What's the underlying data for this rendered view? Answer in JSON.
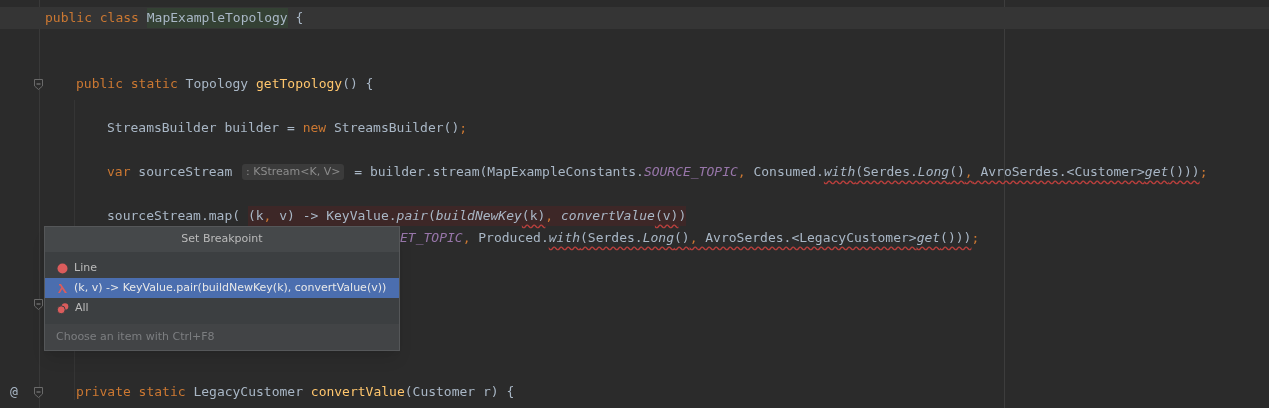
{
  "lines": [
    {
      "current": true,
      "fold": false,
      "covered_left": false,
      "tokens": [
        {
          "text": "public class ",
          "kind": "keyword",
          "squiggly": false
        },
        {
          "text": "MapExampleTopology",
          "kind": "declared",
          "squiggly": false
        },
        {
          "text": " {",
          "kind": "plain",
          "squiggly": false
        }
      ],
      "children": [
        {
          "fold": false
        },
        {
          "fold": false
        },
        {
          "fold": true,
          "covered_left": false,
          "tokens": [
            {
              "text": "public static",
              "kind": "keyword",
              "squiggly": false
            },
            {
              "text": " Topology ",
              "kind": "plain",
              "squiggly": false
            },
            {
              "text": "getTopology",
              "kind": "method",
              "squiggly": false
            },
            {
              "text": "() {",
              "kind": "plain",
              "squiggly": false
            }
          ],
          "children": [
            {
              "fold": false
            },
            {
              "fold": false,
              "covered_left": false,
              "tokens": [
                {
                  "text": "StreamsBuilder builder = ",
                  "kind": "plain",
                  "squiggly": false
                },
                {
                  "text": "new",
                  "kind": "keyword",
                  "squiggly": false
                },
                {
                  "text": " StreamsBuilder()",
                  "kind": "plain",
                  "squiggly": false
                },
                {
                  "text": ";",
                  "kind": "keyword",
                  "squiggly": false
                }
              ]
            },
            {
              "fold": false
            },
            {
              "fold": false,
              "covered_left": false,
              "tokens": [
                {
                  "text": "var",
                  "kind": "keyword",
                  "squiggly": false
                },
                {
                  "text": " sourceStream ",
                  "kind": "plain",
                  "squiggly": false
                },
                {
                  "text": ": KStream<K, V>",
                  "kind": "hint",
                  "squiggly": false
                },
                {
                  "text": " = builder.stream(MapExampleConstants.",
                  "kind": "plain",
                  "squiggly": false
                },
                {
                  "text": "SOURCE_TOPIC",
                  "kind": "constant",
                  "squiggly": false
                },
                {
                  "text": ",",
                  "kind": "keyword",
                  "squiggly": false
                },
                {
                  "text": " Consumed.",
                  "kind": "plain",
                  "squiggly": false
                },
                {
                  "text": "with",
                  "kind": "italic",
                  "squiggly": true
                },
                {
                  "text": "(Serdes.",
                  "kind": "plain",
                  "squiggly": true
                },
                {
                  "text": "Long",
                  "kind": "italic",
                  "squiggly": true
                },
                {
                  "text": "()",
                  "kind": "plain",
                  "squiggly": true
                },
                {
                  "text": ",",
                  "kind": "keyword",
                  "squiggly": true
                },
                {
                  "text": " AvroSerdes.<Customer>",
                  "kind": "plain",
                  "squiggly": true
                },
                {
                  "text": "get",
                  "kind": "italic",
                  "squiggly": true
                },
                {
                  "text": "()))",
                  "kind": "plain",
                  "squiggly": true
                },
                {
                  "text": ";",
                  "kind": "keyword",
                  "squiggly": false
                }
              ]
            },
            {
              "fold": false
            },
            {
              "fold": false,
              "covered_left": false,
              "tokens": [
                {
                  "text": "sourceStream.map( ",
                  "kind": "plain",
                  "squiggly": false
                }
              ],
              "lambda": [
                {
                  "text": "(k",
                  "kind": "plain",
                  "squiggly": false
                },
                {
                  "text": ",",
                  "kind": "keyword",
                  "squiggly": false
                },
                {
                  "text": " v) -> KeyValue.",
                  "kind": "plain",
                  "squiggly": false
                },
                {
                  "text": "pair",
                  "kind": "italic",
                  "squiggly": false
                },
                {
                  "text": "(",
                  "kind": "plain",
                  "squiggly": false
                },
                {
                  "text": "buildNewKey",
                  "kind": "italic",
                  "squiggly": false
                },
                {
                  "text": "(k)",
                  "kind": "plain",
                  "squiggly": true
                },
                {
                  "text": ",",
                  "kind": "keyword",
                  "squiggly": false
                },
                {
                  "text": " convertValue",
                  "kind": "italic",
                  "squiggly": false
                },
                {
                  "text": "(v)",
                  "kind": "plain",
                  "squiggly": true
                },
                {
                  "text": ")",
                  "kind": "plain",
                  "squiggly": false
                }
              ]
            },
            {
              "fold": false,
              "covered_left": true,
              "tokens": [
                {
                  "text": "ET_TOPIC",
                  "kind": "constant",
                  "squiggly": false
                },
                {
                  "text": ",",
                  "kind": "keyword",
                  "squiggly": false
                },
                {
                  "text": " Produced.",
                  "kind": "plain",
                  "squiggly": false
                },
                {
                  "text": "with",
                  "kind": "italic",
                  "squiggly": true
                },
                {
                  "text": "(Serdes.",
                  "kind": "plain",
                  "squiggly": true
                },
                {
                  "text": "Long",
                  "kind": "italic",
                  "squiggly": true
                },
                {
                  "text": "()",
                  "kind": "plain",
                  "squiggly": true
                },
                {
                  "text": ",",
                  "kind": "keyword",
                  "squiggly": true
                },
                {
                  "text": " AvroSerdes.<LegacyCustomer>",
                  "kind": "plain",
                  "squiggly": true
                },
                {
                  "text": "get",
                  "kind": "italic",
                  "squiggly": true
                },
                {
                  "text": "()))",
                  "kind": "plain",
                  "squiggly": true
                },
                {
                  "text": ";",
                  "kind": "keyword",
                  "squiggly": false
                }
              ]
            },
            {
              "fold": false
            },
            {
              "fold": false
            },
            {
              "fold": true
            },
            {
              "fold": false
            },
            {
              "fold": false
            },
            {
              "fold": false
            }
          ]
        },
        {
          "fold": true,
          "covered_left": false,
          "marker": "@",
          "tokens": [
            {
              "text": "private static",
              "kind": "keyword",
              "squiggly": false
            },
            {
              "text": " LegacyCustomer ",
              "kind": "plain",
              "squiggly": false
            },
            {
              "text": "convertValue",
              "kind": "method",
              "squiggly": false
            },
            {
              "text": "(Customer r) {",
              "kind": "plain",
              "squiggly": false
            }
          ]
        }
      ]
    }
  ],
  "popup": {
    "title": "Set Breakpoint",
    "items": [
      {
        "kind": "line",
        "label": "Line",
        "selected": false
      },
      {
        "kind": "lambda",
        "label": "(k, v) -> KeyValue.pair(buildNewKey(k), convertValue(v))",
        "selected": true
      },
      {
        "kind": "all",
        "label": "All",
        "selected": false
      }
    ],
    "footer": "Choose an item with Ctrl+F8"
  }
}
